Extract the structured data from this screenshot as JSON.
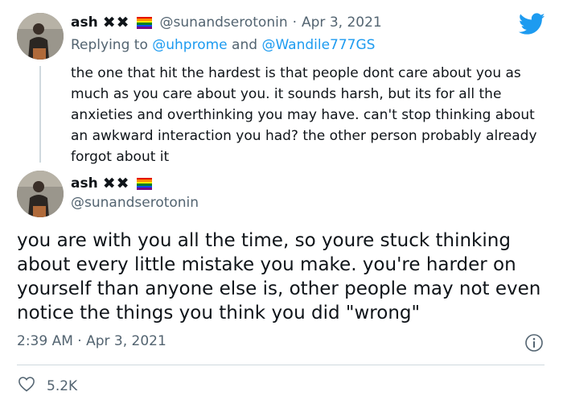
{
  "reply_tweet": {
    "author": {
      "name": "ash",
      "name_suffix": "✖✖",
      "handle": "@sunandserotonin"
    },
    "separator": "·",
    "date": "Apr 3, 2021",
    "replying_to_prefix": "Replying to",
    "replying_to_user1": "@uhprome",
    "replying_to_and": "and",
    "replying_to_user2": "@Wandile777GS",
    "text": "the one that hit the hardest is that people dont care about you as much as you care about you. it sounds harsh, but its for all the anxieties and overthinking you may have. can't stop thinking about an awkward interaction you had? the other person probably already forgot about it"
  },
  "main_tweet": {
    "author": {
      "name": "ash",
      "name_suffix": "✖✖",
      "handle": "@sunandserotonin"
    },
    "text": "you are with you all the time, so youre stuck thinking about every little mistake you make. you're harder on yourself than anyone else is, other people may not even notice the things you think you did \"wrong\"",
    "timestamp": "2:39 AM · Apr 3, 2021",
    "likes": "5.2K"
  },
  "colors": {
    "twitter_blue": "#1d9bf0",
    "muted_text": "#536471",
    "flag": [
      "#e40303",
      "#ff8c00",
      "#ffed00",
      "#008026",
      "#004dff",
      "#750787"
    ]
  },
  "icons": {
    "brand": "twitter-bird-icon",
    "info": "info-icon",
    "like": "heart-icon"
  }
}
